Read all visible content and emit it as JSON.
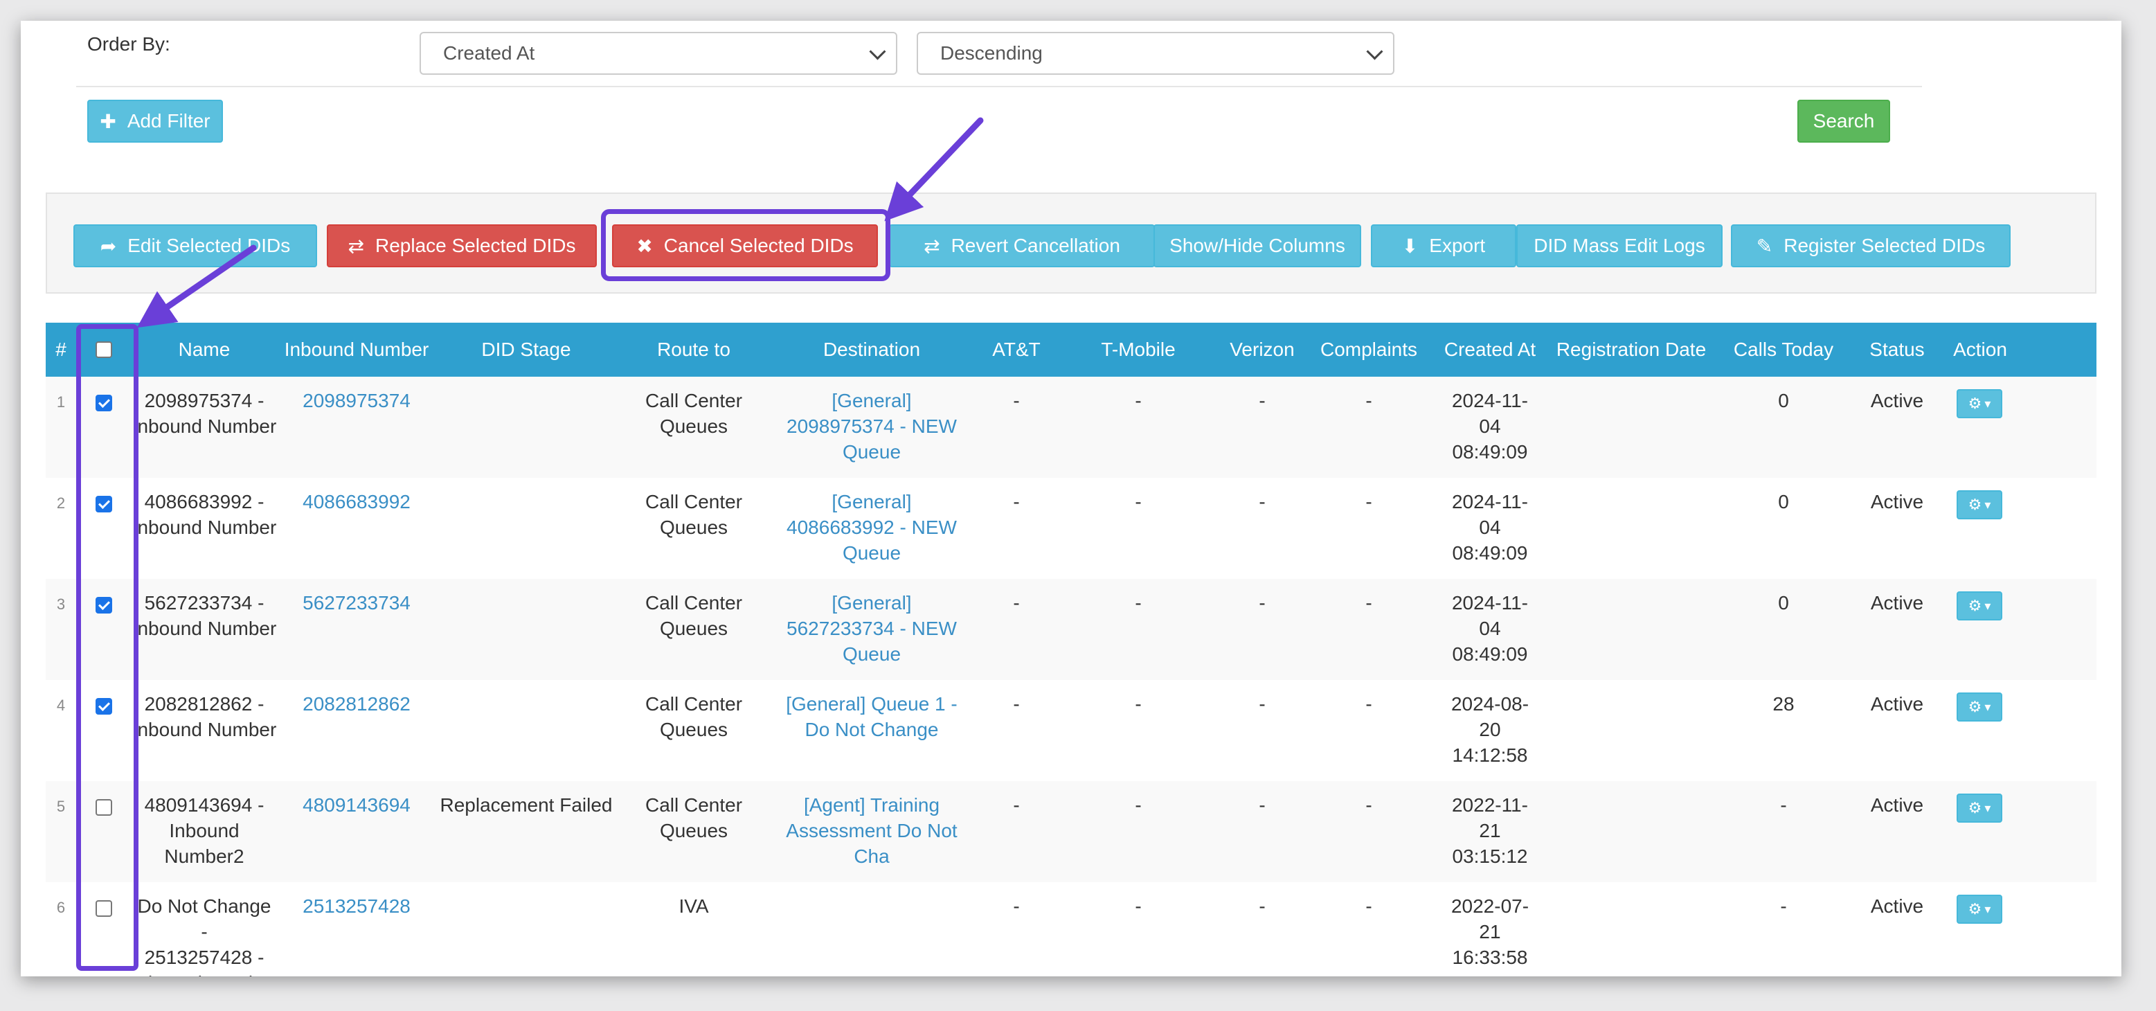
{
  "filters": {
    "order_by_label": "Order By:",
    "order_field": "Created At",
    "order_direction": "Descending",
    "add_filter": "Add Filter",
    "search": "Search"
  },
  "toolbar": {
    "edit_selected": "Edit Selected DIDs",
    "replace_selected": "Replace Selected DIDs",
    "cancel_selected": "Cancel Selected DIDs",
    "revert_cancellation": "Revert Cancellation",
    "show_hide_columns": "Show/Hide Columns",
    "export": "Export",
    "mass_edit_logs": "DID Mass Edit Logs",
    "register_selected": "Register Selected DIDs"
  },
  "table": {
    "headers": [
      "#",
      "Name",
      "Inbound Number",
      "DID Stage",
      "Route to",
      "Destination",
      "AT&T",
      "T-Mobile",
      "Verizon",
      "Complaints",
      "Created At",
      "Registration Date",
      "Calls Today",
      "Status",
      "Action"
    ],
    "rows": [
      {
        "num": "1",
        "checked": true,
        "name": [
          "2098975374 -",
          "Inbound Number"
        ],
        "inbound": "2098975374",
        "stage": "",
        "route": [
          "Call Center",
          "Queues"
        ],
        "destination": [
          "[General]",
          "2098975374 - NEW",
          "Queue"
        ],
        "att": "-",
        "tmobile": "-",
        "verizon": "-",
        "complaints": "-",
        "created": [
          "2024-11-",
          "04",
          "08:49:09"
        ],
        "registration": "",
        "calls": "0",
        "status": "Active"
      },
      {
        "num": "2",
        "checked": true,
        "name": [
          "4086683992 -",
          "Inbound Number"
        ],
        "inbound": "4086683992",
        "stage": "",
        "route": [
          "Call Center",
          "Queues"
        ],
        "destination": [
          "[General]",
          "4086683992 - NEW",
          "Queue"
        ],
        "att": "-",
        "tmobile": "-",
        "verizon": "-",
        "complaints": "-",
        "created": [
          "2024-11-",
          "04",
          "08:49:09"
        ],
        "registration": "",
        "calls": "0",
        "status": "Active"
      },
      {
        "num": "3",
        "checked": true,
        "name": [
          "5627233734 -",
          "Inbound Number"
        ],
        "inbound": "5627233734",
        "stage": "",
        "route": [
          "Call Center",
          "Queues"
        ],
        "destination": [
          "[General]",
          "5627233734 - NEW",
          "Queue"
        ],
        "att": "-",
        "tmobile": "-",
        "verizon": "-",
        "complaints": "-",
        "created": [
          "2024-11-",
          "04",
          "08:49:09"
        ],
        "registration": "",
        "calls": "0",
        "status": "Active"
      },
      {
        "num": "4",
        "checked": true,
        "name": [
          "2082812862 -",
          "Inbound Number"
        ],
        "inbound": "2082812862",
        "stage": "",
        "route": [
          "Call Center",
          "Queues"
        ],
        "destination": [
          "[General] Queue 1 -",
          "Do Not Change"
        ],
        "att": "-",
        "tmobile": "-",
        "verizon": "-",
        "complaints": "-",
        "created": [
          "2024-08-",
          "20",
          "14:12:58"
        ],
        "registration": "",
        "calls": "28",
        "status": "Active"
      },
      {
        "num": "5",
        "checked": false,
        "name": [
          "4809143694 -",
          "Inbound Number2"
        ],
        "inbound": "4809143694",
        "stage": "Replacement Failed",
        "route": [
          "Call Center",
          "Queues"
        ],
        "destination": [
          "[Agent] Training",
          "Assessment Do Not",
          "Cha"
        ],
        "att": "-",
        "tmobile": "-",
        "verizon": "-",
        "complaints": "-",
        "created": [
          "2022-11-",
          "21",
          "03:15:12"
        ],
        "registration": "",
        "calls": "-",
        "status": "Active"
      },
      {
        "num": "6",
        "checked": false,
        "name": [
          "Do Not Change -",
          "2513257428 -",
          "Inbound Number"
        ],
        "inbound": "2513257428",
        "stage": "",
        "route": [
          "IVA"
        ],
        "destination": [],
        "att": "-",
        "tmobile": "-",
        "verizon": "-",
        "complaints": "-",
        "created": [
          "2022-07-",
          "21",
          "16:33:58"
        ],
        "registration": "",
        "calls": "-",
        "status": "Active"
      }
    ]
  },
  "colors": {
    "info": "#5bc0de",
    "danger": "#d9534f",
    "success": "#5cb85c",
    "header": "#2fa0cf",
    "annotation": "#6a3fd8",
    "link": "#3a8fc6"
  }
}
